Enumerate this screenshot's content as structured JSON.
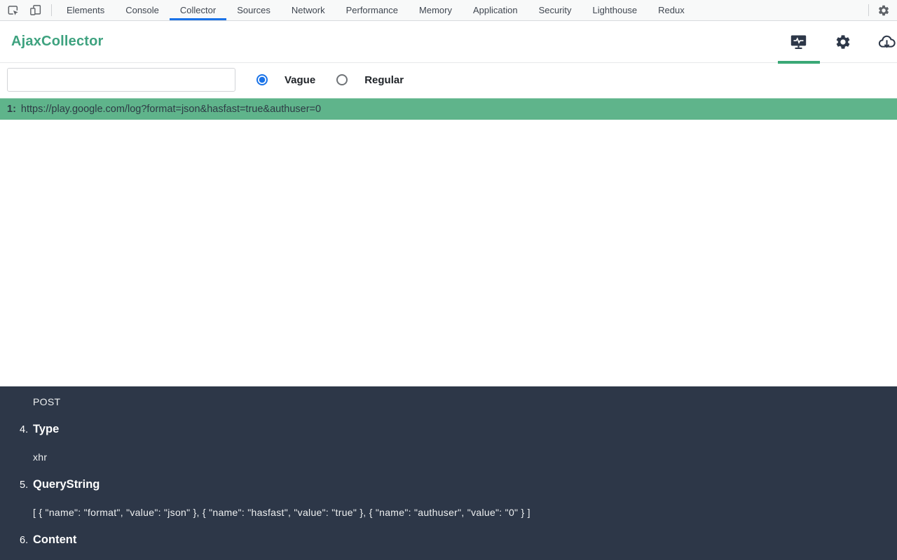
{
  "colors": {
    "accent_green": "#3ea27f",
    "icon_underline_green": "#3aa876",
    "result_row_green": "#5fb48b",
    "panel_dark": "#2d3748",
    "tab_active_blue": "#1a73e8",
    "radio_blue": "#1a73e8"
  },
  "devtools": {
    "tabs": [
      {
        "label": "Elements",
        "active": false
      },
      {
        "label": "Console",
        "active": false
      },
      {
        "label": "Collector",
        "active": true
      },
      {
        "label": "Sources",
        "active": false
      },
      {
        "label": "Network",
        "active": false
      },
      {
        "label": "Performance",
        "active": false
      },
      {
        "label": "Memory",
        "active": false
      },
      {
        "label": "Application",
        "active": false
      },
      {
        "label": "Security",
        "active": false
      },
      {
        "label": "Lighthouse",
        "active": false
      },
      {
        "label": "Redux",
        "active": false
      }
    ]
  },
  "header": {
    "title": "AjaxCollector",
    "icons": [
      {
        "name": "monitor-activity-icon",
        "active": true
      },
      {
        "name": "gear-icon",
        "active": false
      },
      {
        "name": "cloud-download-icon",
        "active": false
      }
    ]
  },
  "controls": {
    "filter_input": {
      "value": "",
      "placeholder": ""
    },
    "radios": [
      {
        "label": "Vague",
        "checked": true
      },
      {
        "label": "Regular",
        "checked": false
      }
    ]
  },
  "results": [
    {
      "index": "1:",
      "url": "https://play.google.com/log?format=json&hasfast=true&authuser=0"
    }
  ],
  "detail_panel": {
    "rows": [
      {
        "type": "value",
        "text": "POST"
      },
      {
        "type": "label",
        "number": "4.",
        "text": "Type"
      },
      {
        "type": "value",
        "text": "xhr"
      },
      {
        "type": "label",
        "number": "5.",
        "text": "QueryString"
      },
      {
        "type": "value",
        "text": "[ { \"name\": \"format\", \"value\": \"json\" }, { \"name\": \"hasfast\", \"value\": \"true\" }, { \"name\": \"authuser\", \"value\": \"0\" } ]"
      },
      {
        "type": "label",
        "number": "6.",
        "text": "Content"
      }
    ]
  }
}
